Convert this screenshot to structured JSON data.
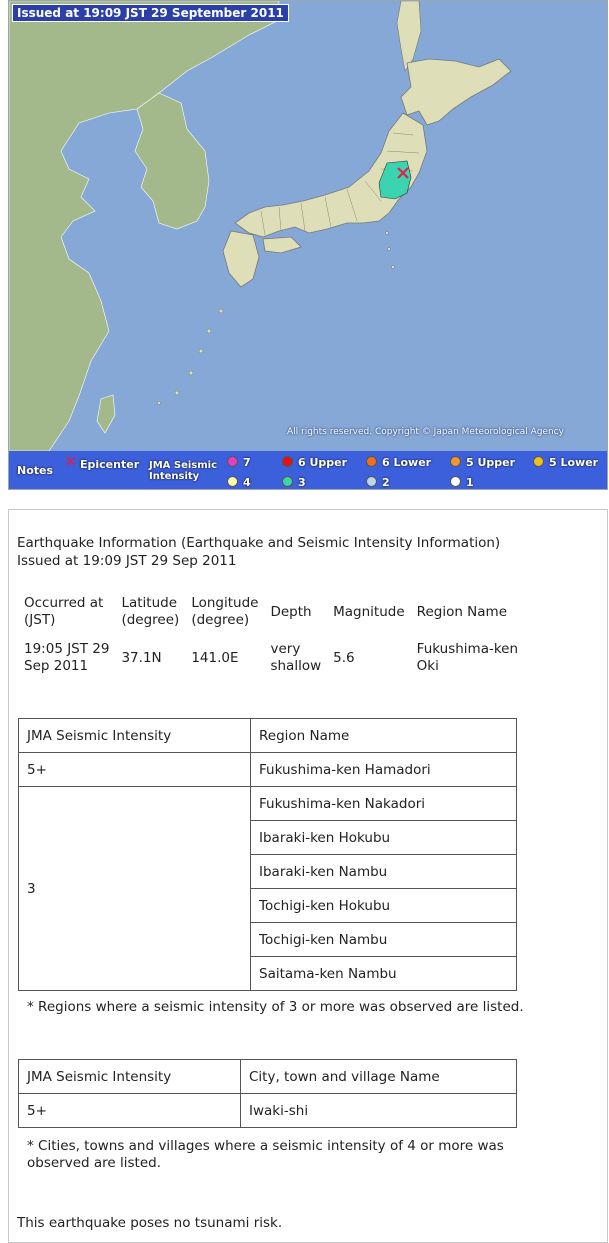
{
  "map": {
    "issued_badge": "Issued at 19:09 JST  29 September 2011",
    "copyright": "All rights reserved. Copyright © Japan Meteorological Agency",
    "colors": {
      "sea": "#86a8d6",
      "land": "#a3b98c",
      "japan": "#dedfb8",
      "intensity_3_region": "#3cd4b0",
      "epicenter": "#e0204a",
      "legend_bar": "#3c5fdc"
    },
    "legend": {
      "notes_label": "Notes",
      "epicenter_label": "Epicenter",
      "epicenter_symbol": "✕",
      "intensity_label": "JMA Seismic Intensity",
      "items": [
        {
          "label": "7",
          "color": "#e040c0"
        },
        {
          "label": "6 Upper",
          "color": "#e81010"
        },
        {
          "label": "6 Lower",
          "color": "#f07020"
        },
        {
          "label": "5 Upper",
          "color": "#f09830"
        },
        {
          "label": "5 Lower",
          "color": "#f0c020"
        },
        {
          "label": "4",
          "color": "#fafab0"
        },
        {
          "label": "3",
          "color": "#3cd4b0"
        },
        {
          "label": "2",
          "color": "#b8d8f0"
        },
        {
          "label": "1",
          "color": "#ffffff"
        }
      ]
    }
  },
  "info": {
    "title": "Earthquake Information (Earthquake and Seismic Intensity Information)",
    "issued": "Issued at 19:09 JST 29 Sep 2011",
    "headers": {
      "occurred_1": "Occurred at",
      "occurred_2": "(JST)",
      "latitude_1": "Latitude",
      "latitude_2": "(degree)",
      "longitude_1": "Longitude",
      "longitude_2": "(degree)",
      "depth": "Depth",
      "magnitude": "Magnitude",
      "region": "Region Name"
    },
    "values": {
      "occurred_1": "19:05 JST 29",
      "occurred_2": "Sep 2011",
      "latitude": "37.1N",
      "longitude": "141.0E",
      "depth_1": "very",
      "depth_2": "shallow",
      "magnitude": "5.6",
      "region_1": "Fukushima-ken",
      "region_2": "Oki"
    },
    "region_table": {
      "col_intensity": "JMA Seismic Intensity",
      "col_region": "Region Name",
      "groups": [
        {
          "intensity": "5+",
          "regions": [
            "Fukushima-ken Hamadori"
          ]
        },
        {
          "intensity": "3",
          "regions": [
            "Fukushima-ken Nakadori",
            "Ibaraki-ken Hokubu",
            "Ibaraki-ken Nambu",
            "Tochigi-ken Hokubu",
            "Tochigi-ken Nambu",
            "Saitama-ken Nambu"
          ]
        }
      ],
      "note": "* Regions where a seismic intensity of 3 or more was observed are listed."
    },
    "city_table": {
      "col_intensity": "JMA Seismic Intensity",
      "col_city": "City, town and village Name",
      "rows": [
        {
          "intensity": "5+",
          "city": "Iwaki-shi"
        }
      ],
      "note": "* Cities, towns and villages where a seismic intensity of 4 or more was observed are listed."
    },
    "tsunami": "This earthquake poses no tsunami risk."
  }
}
